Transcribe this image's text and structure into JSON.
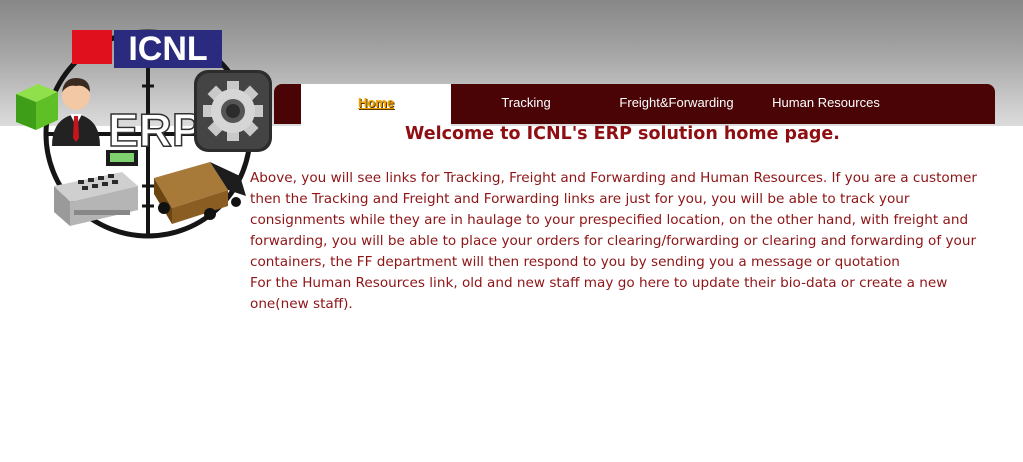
{
  "logo": {
    "brand": "ICNL",
    "product": "ERP",
    "colors": {
      "red_block": "#e0101c",
      "brand_bg": "#2a2b7e",
      "ring": "#151515"
    },
    "icons": [
      "user-icon",
      "cube-icon",
      "gear-icon",
      "cash-register-icon",
      "delivery-truck-icon"
    ]
  },
  "nav": {
    "items": [
      {
        "label": "Home",
        "active": true
      },
      {
        "label": "Tracking",
        "active": false
      },
      {
        "label": "Freight&Forwarding",
        "active": false
      },
      {
        "label": "Human Resources",
        "active": false
      }
    ]
  },
  "main": {
    "title": "Welcome to ICNL's ERP solution home page.",
    "paragraphs": [
      "Above, you will see links for Tracking, Freight and Forwarding and Human Resources. If you are a customer then the Tracking and Freight and Forwarding links are just for you, you will be able to track your consignments while they are in haulage to your prespecified location, on the other hand, with freight and forwarding, you will be able to place your orders for clearing/forwarding or clearing and forwarding of your containers, the FF department will then respond to you by sending you a message or quotation",
      "For the Human Resources link, old and new staff may go here to update their bio-data or create a new one(new staff)."
    ]
  },
  "colors": {
    "nav_bg": "#4a0406",
    "active_tab_text": "#f0a100",
    "text_maroon": "#8e1416"
  }
}
